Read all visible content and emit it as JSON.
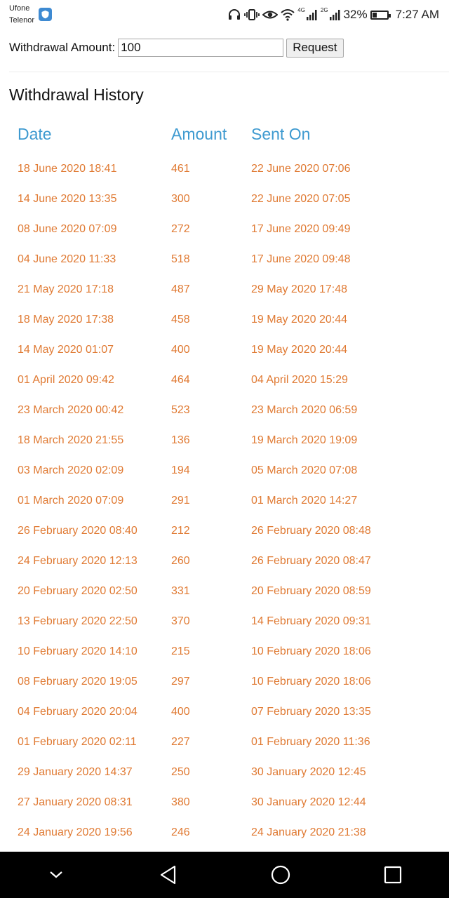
{
  "status_bar": {
    "carrier_1": "Ufone",
    "carrier_2": "Telenor",
    "net_1": "4G",
    "net_2": "2G",
    "battery": "32%",
    "battery_level": 0.32,
    "time": "7:27 AM",
    "icons": [
      "shield-icon",
      "headphones-icon",
      "vibrate-icon",
      "eye-icon",
      "wifi-icon",
      "signal-icon",
      "signal-icon",
      "battery-icon"
    ]
  },
  "form": {
    "label": "Withdrawal Amount:",
    "amount_value": "100",
    "request_label": "Request"
  },
  "history": {
    "title": "Withdrawal History",
    "columns": [
      "Date",
      "Amount",
      "Sent On"
    ],
    "rows": [
      {
        "date": "18 June 2020 18:41",
        "amount": "461",
        "sent_on": "22 June 2020 07:06"
      },
      {
        "date": "14 June 2020 13:35",
        "amount": "300",
        "sent_on": "22 June 2020 07:05"
      },
      {
        "date": "08 June 2020 07:09",
        "amount": "272",
        "sent_on": "17 June 2020 09:49"
      },
      {
        "date": "04 June 2020 11:33",
        "amount": "518",
        "sent_on": "17 June 2020 09:48"
      },
      {
        "date": "21 May 2020 17:18",
        "amount": "487",
        "sent_on": "29 May 2020 17:48"
      },
      {
        "date": "18 May 2020 17:38",
        "amount": "458",
        "sent_on": "19 May 2020 20:44"
      },
      {
        "date": "14 May 2020 01:07",
        "amount": "400",
        "sent_on": "19 May 2020 20:44"
      },
      {
        "date": "01 April 2020 09:42",
        "amount": "464",
        "sent_on": "04 April 2020 15:29"
      },
      {
        "date": "23 March 2020 00:42",
        "amount": "523",
        "sent_on": "23 March 2020 06:59"
      },
      {
        "date": "18 March 2020 21:55",
        "amount": "136",
        "sent_on": "19 March 2020 19:09"
      },
      {
        "date": "03 March 2020 02:09",
        "amount": "194",
        "sent_on": "05 March 2020 07:08"
      },
      {
        "date": "01 March 2020 07:09",
        "amount": "291",
        "sent_on": "01 March 2020 14:27"
      },
      {
        "date": "26 February 2020 08:40",
        "amount": "212",
        "sent_on": "26 February 2020 08:48"
      },
      {
        "date": "24 February 2020 12:13",
        "amount": "260",
        "sent_on": "26 February 2020 08:47"
      },
      {
        "date": "20 February 2020 02:50",
        "amount": "331",
        "sent_on": "20 February 2020 08:59"
      },
      {
        "date": "13 February 2020 22:50",
        "amount": "370",
        "sent_on": "14 February 2020 09:31"
      },
      {
        "date": "10 February 2020 14:10",
        "amount": "215",
        "sent_on": "10 February 2020 18:06"
      },
      {
        "date": "08 February 2020 19:05",
        "amount": "297",
        "sent_on": "10 February 2020 18:06"
      },
      {
        "date": "04 February 2020 20:04",
        "amount": "400",
        "sent_on": "07 February 2020 13:35"
      },
      {
        "date": "01 February 2020 02:11",
        "amount": "227",
        "sent_on": "01 February 2020 11:36"
      },
      {
        "date": "29 January 2020 14:37",
        "amount": "250",
        "sent_on": "30 January 2020 12:45"
      },
      {
        "date": "27 January 2020 08:31",
        "amount": "380",
        "sent_on": "30 January 2020 12:44"
      },
      {
        "date": "24 January 2020 19:56",
        "amount": "246",
        "sent_on": "24 January 2020 21:38"
      }
    ]
  },
  "colors": {
    "header_text": "#3e9ad0",
    "row_text": "#e07a33",
    "nav_bg": "#000000"
  },
  "nav_bar": {
    "icons": [
      "chevron-down-icon",
      "back-icon",
      "home-icon",
      "recents-icon"
    ]
  }
}
